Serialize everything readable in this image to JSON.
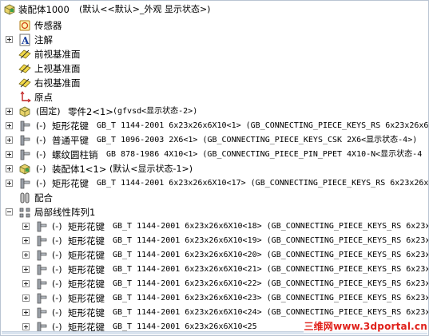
{
  "tree": {
    "root": {
      "name": "装配体1000",
      "config": "(默认<<默认>_外观 显示状态>)"
    },
    "sensors": "传感器",
    "annotations": "注解",
    "planes": [
      "前视基准面",
      "上视基准面",
      "右视基准面"
    ],
    "origin": "原点",
    "components": [
      {
        "state": "(固定)",
        "name": "零件2<1>",
        "detail": "(gfvsd<显示状态-2>)"
      },
      {
        "state": "(-)",
        "name": "矩形花键",
        "detail": "GB_T 1144-2001 6x23x26x6X10<1> (GB_CONNECTING_PIECE_KEYS_RS 6x23x26x6"
      },
      {
        "state": "(-)",
        "name": "普通平键",
        "detail": "GB_T 1096-2003 2X6<1> (GB_CONNECTING_PIECE_KEYS_CSK 2X6<显示状态-4>)"
      },
      {
        "state": "(-)",
        "name": "螺纹圆柱销",
        "detail": "GB 878-1986 4X10<1> (GB_CONNECTING_PIECE_PIN_PPET 4X10-N<显示状态-4"
      },
      {
        "state": "(-)",
        "name": "装配体1<1>",
        "detail": "(默认<显示状态-1>)"
      },
      {
        "state": "(-)",
        "name": "矩形花键",
        "detail": "GB_T 1144-2001 6x23x26x6X10<17> (GB_CONNECTING_PIECE_KEYS_RS 6x23x26x"
      }
    ],
    "mates": "配合",
    "pattern": {
      "name": "局部线性阵列1",
      "children": [
        {
          "state": "(-)",
          "name": "矩形花键",
          "detail": "GB_T 1144-2001 6x23x26x6X10<18> (GB_CONNECTING_PIECE_KEYS_RS 6x23x"
        },
        {
          "state": "(-)",
          "name": "矩形花键",
          "detail": "GB_T 1144-2001 6x23x26x6X10<19> (GB_CONNECTING_PIECE_KEYS_RS 6x23x"
        },
        {
          "state": "(-)",
          "name": "矩形花键",
          "detail": "GB_T 1144-2001 6x23x26x6X10<20> (GB_CONNECTING_PIECE_KEYS_RS 6x23x"
        },
        {
          "state": "(-)",
          "name": "矩形花键",
          "detail": "GB_T 1144-2001 6x23x26x6X10<21> (GB_CONNECTING_PIECE_KEYS_RS 6x23x"
        },
        {
          "state": "(-)",
          "name": "矩形花键",
          "detail": "GB_T 1144-2001 6x23x26x6X10<22> (GB_CONNECTING_PIECE_KEYS_RS 6x23x"
        },
        {
          "state": "(-)",
          "name": "矩形花键",
          "detail": "GB_T 1144-2001 6x23x26x6X10<23> (GB_CONNECTING_PIECE_KEYS_RS 6x23x"
        },
        {
          "state": "(-)",
          "name": "矩形花键",
          "detail": "GB_T 1144-2001 6x23x26x6X10<24> (GB_CONNECTING_PIECE_KEYS_RS 6x23x"
        },
        {
          "state": "(-)",
          "name": "矩形花键",
          "detail": "GB_T 1144-2001 6x23x26x6X10<25"
        }
      ]
    }
  },
  "watermark": "三维网www.3dportal.cn",
  "colors": {
    "border": "#b9c4d2",
    "watermark": "#e0201a",
    "plane": "#e6c63a",
    "part": "#8a8f98"
  }
}
